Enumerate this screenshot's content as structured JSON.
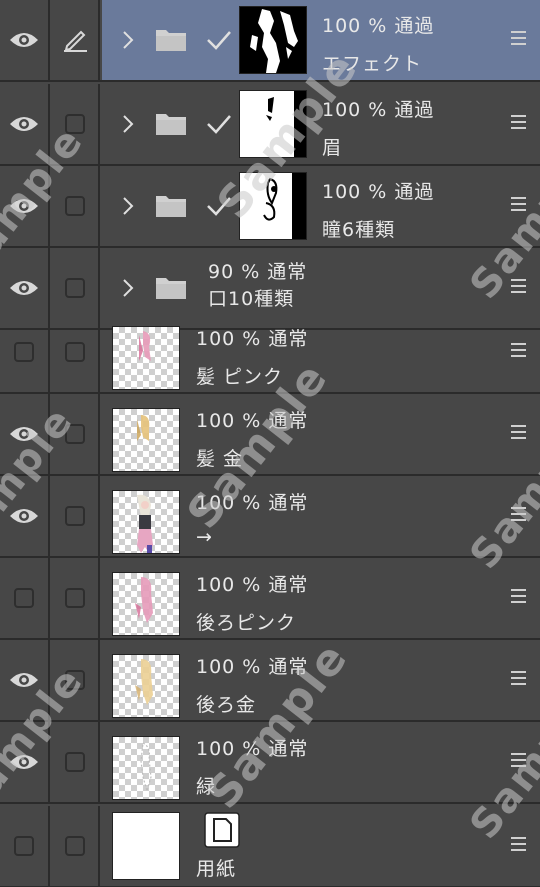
{
  "watermark_text": "Sample",
  "layers": [
    {
      "visible": true,
      "edit": true,
      "selected": true,
      "type": "folder",
      "checked": true,
      "thumb": "bw1",
      "opacity_mode": "100 % 通過",
      "name": "エフェクト"
    },
    {
      "visible": true,
      "edit": false,
      "selected": false,
      "type": "folder",
      "checked": true,
      "thumb": "bw2",
      "opacity_mode": "100 % 通過",
      "name": "眉"
    },
    {
      "visible": true,
      "edit": false,
      "selected": false,
      "type": "folder",
      "checked": true,
      "thumb": "bw3",
      "opacity_mode": "100 % 通過",
      "name": "瞳6種類"
    },
    {
      "visible": true,
      "edit": false,
      "selected": false,
      "type": "folder-nothumb",
      "checked": false,
      "thumb": "none",
      "opacity_mode": "90 % 通常",
      "name": "口10種類"
    },
    {
      "visible": false,
      "edit": false,
      "selected": false,
      "type": "layer",
      "thumb": "pink",
      "opacity_mode": "100 % 通常",
      "name": "髪 ピンク"
    },
    {
      "visible": true,
      "edit": false,
      "selected": false,
      "type": "layer",
      "thumb": "gold",
      "opacity_mode": "100 % 通常",
      "name": "髪 金"
    },
    {
      "visible": true,
      "edit": false,
      "selected": false,
      "type": "layer",
      "thumb": "character",
      "opacity_mode": "100 % 通常",
      "name": "→"
    },
    {
      "visible": false,
      "edit": false,
      "selected": false,
      "type": "layer",
      "thumb": "pink2",
      "opacity_mode": "100 % 通常",
      "name": "後ろピンク"
    },
    {
      "visible": true,
      "edit": false,
      "selected": false,
      "type": "layer",
      "thumb": "gold2",
      "opacity_mode": "100 % 通常",
      "name": "後ろ金"
    },
    {
      "visible": true,
      "edit": false,
      "selected": false,
      "type": "layer",
      "thumb": "lines",
      "opacity_mode": "100 % 通常",
      "name": "緑"
    },
    {
      "visible": false,
      "edit": false,
      "selected": false,
      "type": "paper",
      "thumb": "white",
      "opacity_mode": "",
      "name": "用紙"
    }
  ],
  "colors": {
    "panel_bg": "#474747",
    "selected_bg": "#6a7a9b",
    "divider": "#2b2b2b",
    "text": "#e8e8e8"
  }
}
